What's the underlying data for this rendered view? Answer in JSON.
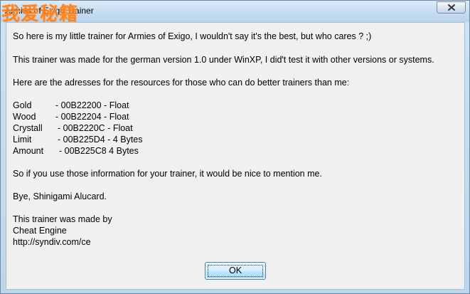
{
  "window": {
    "title": "Armies of Exigo Trainer",
    "watermark": "我爱秘籍"
  },
  "message": {
    "intro": "So here is my little trainer for Armies of Exigo, I wouldn't say it's the best, but who cares ? ;)",
    "version_note": "This trainer was made for the german version 1.0 under WinXP, I did't test it with other versions or systems.",
    "addresses_intro": "Here are the adresses for the resources for those who can do better trainers than me:",
    "resources": [
      {
        "name": "Gold",
        "value": "- 00B22200 - Float"
      },
      {
        "name": "Wood",
        "value": "- 00B22204 - Float"
      },
      {
        "name": "Crystall",
        "value": "- 00B2220C - Float"
      },
      {
        "name": "Limit",
        "value": "- 00B225D4 - 4 Bytes"
      },
      {
        "name": "Amount",
        "value": "- 00B225C8 4 Bytes"
      }
    ],
    "mention": "So if you use those information for your trainer, it would be nice to mention me.",
    "bye": "Bye, Shinigami Alucard.",
    "made_by": "This trainer was made by",
    "tool": "Cheat Engine",
    "url": "http://syndiv.com/ce"
  },
  "buttons": {
    "ok_label": "OK"
  },
  "icons": {
    "close": "close-icon"
  },
  "colors": {
    "watermark": "#ff7f1a",
    "dialog_bg": "#f0f0f0",
    "title_bar": "#c6ddf0"
  }
}
